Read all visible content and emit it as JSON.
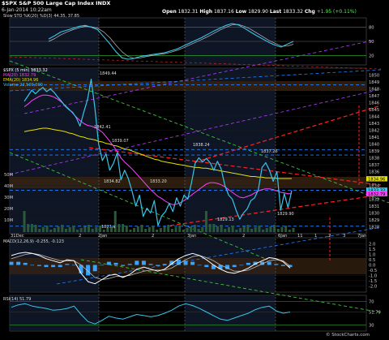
{
  "header": {
    "title": "$SPX S&P 500 Large Cap Index INDX",
    "date": "6-Jan-2014 10:22am",
    "open_label": "Open",
    "open": "1832.31",
    "high_label": "High",
    "high": "1837.16",
    "low_label": "Low",
    "low": "1829.90",
    "last_label": "Last",
    "last": "1833.32",
    "chg_label": "Chg",
    "chg": "+1.95 (+0.11%)",
    "brand": "© StockCharts.com"
  },
  "colors": {
    "price": "#39c4e8",
    "sma20": "#ff40ff",
    "ema50": "#e8e000",
    "macd": "#ffffff",
    "signal": "#bbbbbb",
    "histogram": "#39a4ff",
    "rsi": "#39c4e8",
    "stoch": "#39c4e8",
    "channel_red": "#ff2020",
    "trend_green": "#40c040",
    "trend_purple": "#b040ff",
    "trend_blue": "#2080ff"
  },
  "chart_data": [
    {
      "type": "line",
      "panel": "slow-stochastic",
      "legend": "Slow STO %K(20) %D(3) 44.35, 37.85",
      "ylim": [
        0,
        100
      ],
      "yticks": [
        20,
        50,
        80
      ],
      "series": [
        {
          "name": "%K",
          "values": [
            55,
            62,
            70,
            74,
            78,
            82,
            84,
            80,
            75,
            60,
            45,
            28,
            15,
            12,
            14,
            18,
            20,
            22,
            24,
            26,
            30,
            34,
            40,
            46,
            52,
            58,
            65,
            72,
            78,
            84,
            88,
            85,
            78,
            70,
            62,
            55,
            48,
            42,
            38,
            44,
            50
          ]
        },
        {
          "name": "%D",
          "values": [
            50,
            56,
            64,
            70,
            75,
            79,
            82,
            81,
            78,
            70,
            58,
            42,
            28,
            18,
            14,
            15,
            18,
            20,
            22,
            24,
            27,
            31,
            36,
            42,
            48,
            54,
            60,
            67,
            74,
            80,
            85,
            86,
            82,
            76,
            68,
            60,
            52,
            46,
            40,
            40,
            44
          ]
        }
      ]
    },
    {
      "type": "line",
      "panel": "price",
      "legend": [
        "$SPX (5 min) 1833.32",
        "MA(20) 1832.79",
        "EMA(20) 1834.96",
        "Volume 22,500,000"
      ],
      "ylim": [
        1827,
        1851
      ],
      "yticks": [
        "1850",
        "1849",
        "1848",
        "1847",
        "1846",
        "1845",
        "1844",
        "1843",
        "1842",
        "1841",
        "1840",
        "1839",
        "1838",
        "1837",
        "1836",
        "1835",
        "1834",
        "1833",
        "1832",
        "1831",
        "1830",
        "1829",
        "1828"
      ],
      "right_value_labels": [
        "1834.96",
        "1833.32",
        "1832.79"
      ],
      "volume_ticks": [
        "50M",
        "40M",
        "30M",
        "20M",
        "10M"
      ],
      "x_tick_labels": [
        "31Dec",
        "2",
        "2Jan",
        "2",
        "3Jan",
        "2",
        "6Jan",
        "11",
        "1",
        "2",
        "3",
        "7Jan"
      ],
      "annotations": [
        "1849.44",
        "1842.41",
        "1839.07",
        "1834.82",
        "1833.20",
        "1838.24",
        "1837.26",
        "1829.13",
        "1829.90",
        "1827.x"
      ],
      "series": [
        {
          "name": "$SPX",
          "values": [
            1846.2,
            1847.0,
            1847.8,
            1847.3,
            1847.8,
            1848.2,
            1847.6,
            1848.0,
            1847.5,
            1846.8,
            1846.2,
            1845.5,
            1845.0,
            1844.6,
            1843.8,
            1842.6,
            1844.6,
            1846.4,
            1849.4,
            1845.2,
            1840.0,
            1837.6,
            1838.6,
            1836.2,
            1837.2,
            1838.7,
            1834.8,
            1836.2,
            1835.0,
            1833.2,
            1831.0,
            1832.6,
            1829.5,
            1830.7,
            1830.0,
            1831.8,
            1828.2,
            1829.6,
            1830.2,
            1831.4,
            1830.2,
            1832.2,
            1831.0,
            1832.6,
            1832.0,
            1834.4,
            1837.2,
            1838.0,
            1837.4,
            1837.9,
            1837.3,
            1836.2,
            1837.5,
            1836.4,
            1834.0,
            1832.6,
            1832.0,
            1830.4,
            1829.1,
            1830.0,
            1830.6,
            1831.8,
            1832.2,
            1833.4,
            1836.6,
            1837.3,
            1836.2,
            1834.6,
            1836.0,
            1830.4,
            1832.8,
            1830.8,
            1833.3
          ]
        },
        {
          "name": "MA(20)",
          "values": [
            1845.4,
            1845.8,
            1846.3,
            1846.6,
            1846.9,
            1847.1,
            1847.1,
            1847.0,
            1846.8,
            1846.5,
            1846.1,
            1845.6,
            1845.1,
            1844.5,
            1843.9,
            1843.4,
            1843.0,
            1842.7,
            1842.6,
            1842.4,
            1842.1,
            1841.7,
            1841.1,
            1840.4,
            1839.7,
            1838.9,
            1838.0,
            1837.4,
            1836.9,
            1836.4,
            1835.8,
            1835.2,
            1834.6,
            1834.0,
            1833.4,
            1832.9,
            1832.4,
            1832.1,
            1831.7,
            1831.4,
            1831.2,
            1831.3,
            1831.5,
            1831.8,
            1832.2,
            1832.6,
            1833.0,
            1833.4,
            1833.8,
            1834.2,
            1834.4,
            1834.4,
            1834.3,
            1834.1,
            1833.8,
            1833.4,
            1833.0,
            1832.6,
            1832.3,
            1832.2,
            1832.4,
            1832.6,
            1832.9,
            1833.2,
            1833.4,
            1833.5,
            1833.5,
            1833.4,
            1833.2,
            1833.0,
            1832.9,
            1832.8,
            1832.8
          ]
        },
        {
          "name": "EMA(50)",
          "values": [
            1841.8,
            1841.9,
            1842.0,
            1842.1,
            1842.2,
            1842.3,
            1842.3,
            1842.2,
            1842.1,
            1842.0,
            1841.9,
            1841.8,
            1841.6,
            1841.5,
            1841.3,
            1841.1,
            1841.0,
            1840.8,
            1840.7,
            1840.6,
            1840.4,
            1840.3,
            1840.1,
            1840.0,
            1839.8,
            1839.7,
            1839.5,
            1839.3,
            1839.2,
            1839.0,
            1838.8,
            1838.6,
            1838.4,
            1838.2,
            1838.0,
            1837.8,
            1837.7,
            1837.5,
            1837.4,
            1837.3,
            1837.2,
            1837.1,
            1837.0,
            1836.9,
            1836.8,
            1836.7,
            1836.6,
            1836.6,
            1836.5,
            1836.5,
            1836.4,
            1836.3,
            1836.2,
            1836.1,
            1836.0,
            1835.9,
            1835.8,
            1835.7,
            1835.6,
            1835.5,
            1835.4,
            1835.3,
            1835.3,
            1835.2,
            1835.2,
            1835.1,
            1835.1,
            1835.1,
            1835.0,
            1835.0,
            1835.0,
            1835.0,
            1835.0
          ]
        }
      ]
    },
    {
      "type": "line",
      "panel": "macd",
      "legend": "MACD(12,26,9) -0.255, -0.123",
      "ylim": [
        -2.6,
        2.6
      ],
      "yticks": [
        "2.0",
        "1.5",
        "1.0",
        "0.5",
        "0.0",
        "-0.5",
        "-1.0",
        "-1.5",
        "-2.0"
      ],
      "series": [
        {
          "name": "MACD",
          "values": [
            0.9,
            1.1,
            1.2,
            1.1,
            0.9,
            0.6,
            0.4,
            0.2,
            0.5,
            0.4,
            -0.8,
            -1.6,
            -1.8,
            -1.4,
            -1.0,
            -0.9,
            -1.2,
            -0.9,
            -0.4,
            -0.2,
            -0.4,
            -0.6,
            -0.4,
            0.1,
            0.6,
            0.9,
            1.1,
            0.9,
            0.5,
            0.0,
            -0.4,
            -0.7,
            -0.8,
            -0.6,
            -0.3,
            0.1,
            0.4,
            0.7,
            0.6,
            0.3,
            -0.3
          ]
        },
        {
          "name": "Signal",
          "values": [
            0.6,
            0.8,
            1.0,
            1.1,
            1.0,
            0.8,
            0.6,
            0.4,
            0.4,
            0.4,
            0.0,
            -0.6,
            -1.2,
            -1.4,
            -1.3,
            -1.1,
            -1.1,
            -1.0,
            -0.8,
            -0.6,
            -0.5,
            -0.5,
            -0.5,
            -0.3,
            0.1,
            0.5,
            0.8,
            0.9,
            0.7,
            0.4,
            0.0,
            -0.3,
            -0.6,
            -0.6,
            -0.5,
            -0.2,
            0.1,
            0.4,
            0.5,
            0.4,
            -0.1
          ]
        }
      ]
    },
    {
      "type": "line",
      "panel": "rsi",
      "legend": "RSI(14) 51.79",
      "ylim": [
        20,
        80
      ],
      "yticks": [
        "70",
        "51.79",
        "30"
      ],
      "series": [
        {
          "name": "RSI(14)",
          "values": [
            60,
            64,
            66,
            62,
            60,
            58,
            55,
            56,
            58,
            62,
            48,
            36,
            32,
            38,
            45,
            42,
            40,
            44,
            48,
            46,
            44,
            46,
            50,
            55,
            62,
            66,
            63,
            58,
            52,
            46,
            40,
            38,
            42,
            46,
            50,
            56,
            60,
            62,
            54,
            50,
            52
          ]
        }
      ]
    }
  ]
}
